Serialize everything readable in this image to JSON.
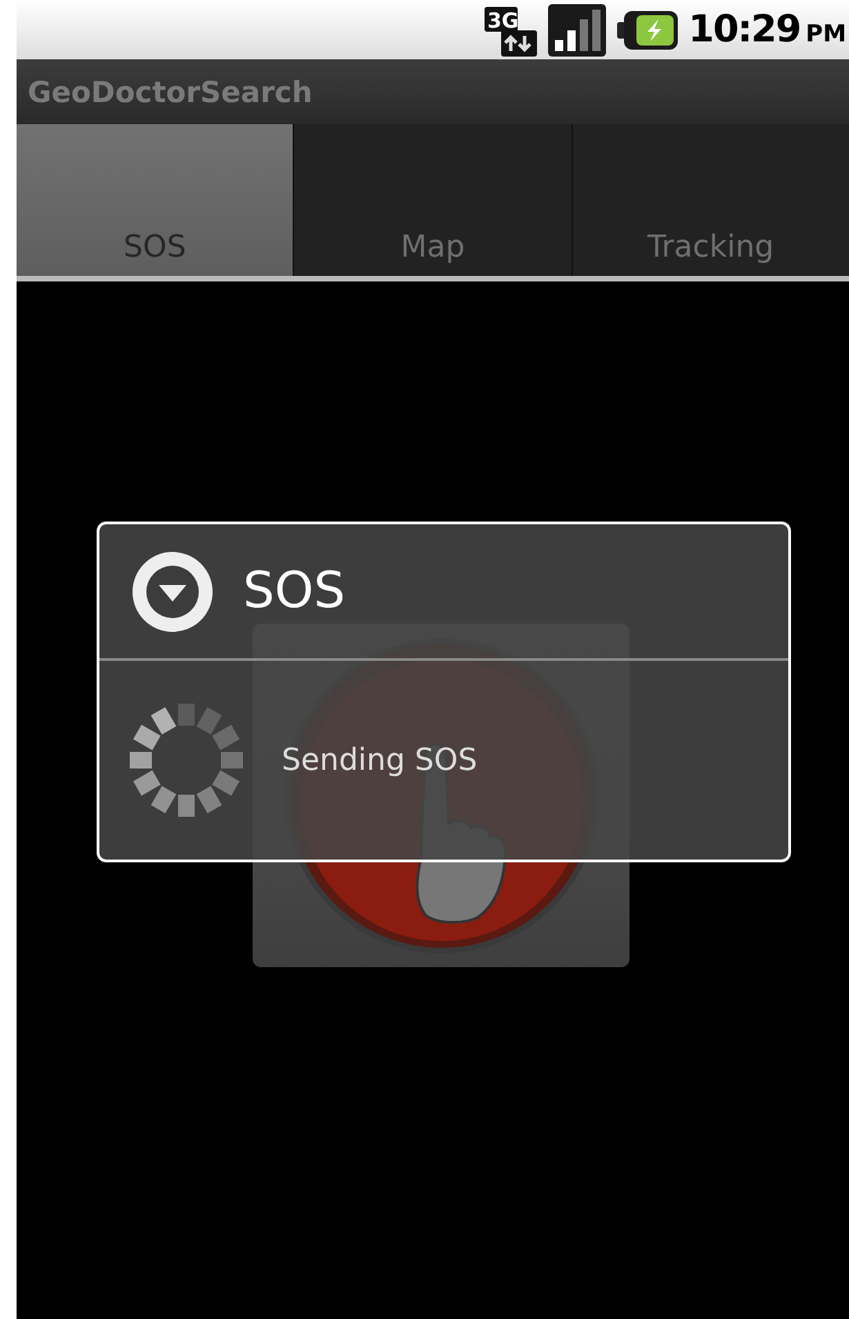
{
  "status_bar": {
    "network": "3G",
    "time": "10:29",
    "meridiem": "PM"
  },
  "app_bar": {
    "title": "GeoDoctorSearch"
  },
  "tabs": [
    {
      "label": "SOS",
      "selected": true
    },
    {
      "label": "Map",
      "selected": false
    },
    {
      "label": "Tracking",
      "selected": false
    }
  ],
  "dialog": {
    "title": "SOS",
    "message": "Sending SOS"
  }
}
